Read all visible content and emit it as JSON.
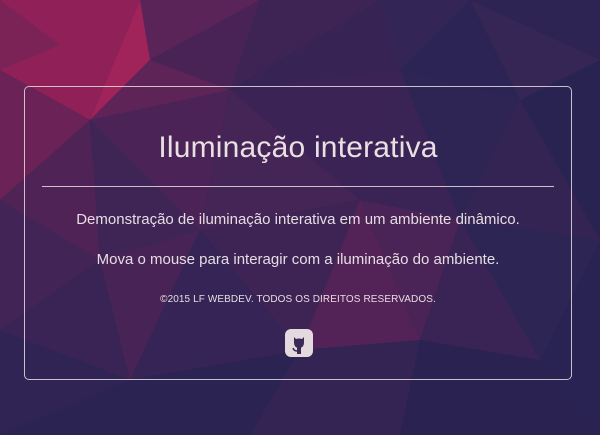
{
  "panel": {
    "title": "Iluminação interativa",
    "description": "Demonstração de iluminação interativa em um ambiente dinâmico.",
    "instruction": "Mova o mouse para interagir com a iluminação do ambiente.",
    "copyright": "©2015 LF WEBDEV. TODOS OS DIREITOS RESERVADOS.",
    "github_icon": "github-icon"
  },
  "colors": {
    "background_base": "#2c2454",
    "accent_magenta": "#a0245a",
    "text": "#e6dde2"
  }
}
